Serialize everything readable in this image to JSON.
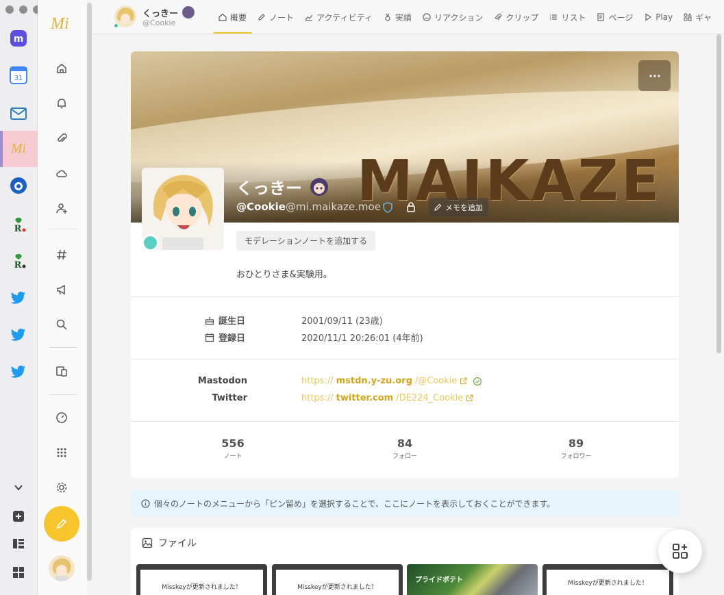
{
  "dock": {
    "apps": [
      "mastodon-icon",
      "calendar-icon",
      "mail-icon",
      "misskey-icon",
      "beacon-icon",
      "rakuten-icon",
      "rakuten-icon",
      "twitter-icon",
      "twitter-icon",
      "twitter-icon"
    ],
    "calendar_day": "31",
    "misskey_label": "Mi"
  },
  "nav": {
    "logo": "Mi",
    "items": [
      "home-icon",
      "bell-icon",
      "paperclip-icon",
      "cloud-icon",
      "user-plus-icon",
      "hashtag-icon",
      "megaphone-icon",
      "search-icon",
      "devices-icon",
      "gauge-icon",
      "grid-icon",
      "gear-icon"
    ]
  },
  "header": {
    "user_name": "くっきー",
    "user_handle": "@Cookie",
    "tabs": [
      {
        "label": "概要",
        "icon": "home-icon",
        "active": true
      },
      {
        "label": "ノート",
        "icon": "pencil-icon"
      },
      {
        "label": "アクティビティ",
        "icon": "chart-icon"
      },
      {
        "label": "実績",
        "icon": "medal-icon"
      },
      {
        "label": "リアクション",
        "icon": "smile-icon"
      },
      {
        "label": "クリップ",
        "icon": "paperclip-icon"
      },
      {
        "label": "リスト",
        "icon": "list-icon"
      },
      {
        "label": "ページ",
        "icon": "page-icon"
      },
      {
        "label": "Play",
        "icon": "play-icon"
      },
      {
        "label": "ギャ",
        "icon": "icons-icon"
      }
    ]
  },
  "profile": {
    "banner_text": "MAIKAZE",
    "name": "くっきー",
    "handle_user": "@Cookie",
    "handle_host": "@mi.maikaze.moe",
    "memo_label": "メモを追加",
    "modnote_label": "モデレーションノートを追加する",
    "bio": "おひとりさま&実験用。",
    "birthday_label": "誕生日",
    "birthday_value": "2001/09/11 (23歳)",
    "joined_label": "登録日",
    "joined_value": "2020/11/1 20:26:01 (4年前)",
    "fields": [
      {
        "name": "Mastodon",
        "proto": "https://",
        "domain": "mstdn.y-zu.org",
        "path": "/@Cookie",
        "verified": true
      },
      {
        "name": "Twitter",
        "proto": "https://",
        "domain": "twitter.com",
        "path": "/DE224_Cookie",
        "verified": false
      }
    ],
    "stats": [
      {
        "value": "556",
        "label": "ノート"
      },
      {
        "value": "84",
        "label": "フォロー"
      },
      {
        "value": "89",
        "label": "フォロワー"
      }
    ]
  },
  "pinned_info": "個々のノートのメニューから「ピン留め」を選択することで、ここにノートを表示しておくことができます。",
  "files": {
    "title": "ファイル",
    "thumbs": [
      {
        "caption": "Misskeyが更新されました！"
      },
      {
        "caption": "Misskeyが更新されました！"
      },
      {
        "caption": "プライドポテト"
      },
      {
        "caption": "Misskeyが更新されました！"
      }
    ]
  },
  "colors": {
    "accent": "#f7c52b",
    "link_domain": "#d3a519",
    "info_bg": "#e6f4fb"
  }
}
